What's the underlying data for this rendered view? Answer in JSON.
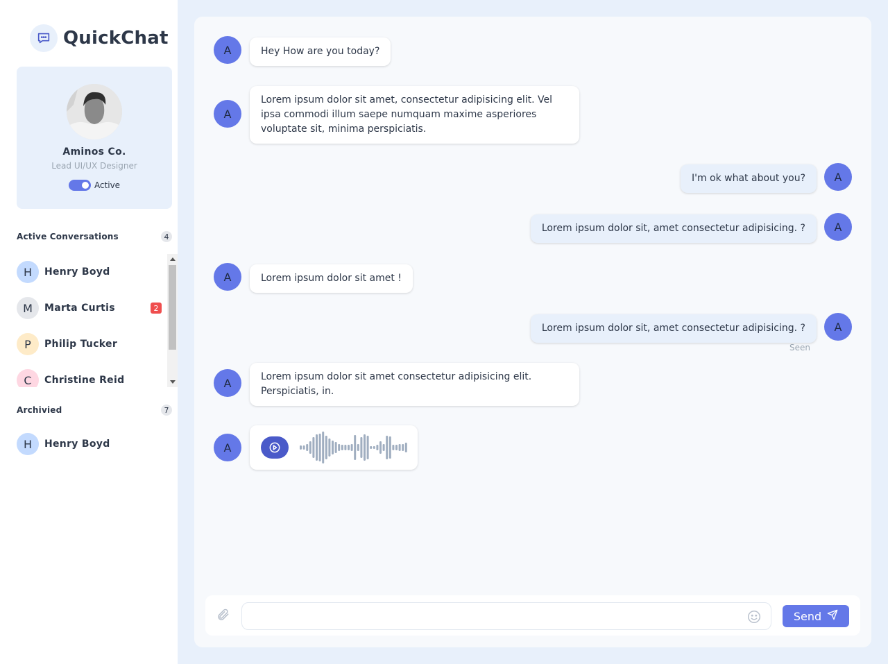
{
  "brand": {
    "title": "QuickChat",
    "icon": "chat-bubble-icon"
  },
  "profile": {
    "name": "Aminos Co.",
    "role": "Lead UI/UX Designer",
    "status_label": "Active",
    "status_on": true
  },
  "active_conversations": {
    "title": "Active Conversations",
    "count": "4",
    "items": [
      {
        "initial": "H",
        "name": "Henry Boyd",
        "color": "#c3dafe",
        "unread": ""
      },
      {
        "initial": "M",
        "name": "Marta Curtis",
        "color": "#e5e7eb",
        "unread": "2"
      },
      {
        "initial": "P",
        "name": "Philip Tucker",
        "color": "#feebc8",
        "unread": ""
      },
      {
        "initial": "C",
        "name": "Christine Reid",
        "color": "#fed7e2",
        "unread": ""
      }
    ]
  },
  "archived": {
    "title": "Archivied",
    "count": "7",
    "items": [
      {
        "initial": "H",
        "name": "Henry Boyd",
        "color": "#c3dafe"
      }
    ]
  },
  "messages": [
    {
      "from": "in",
      "avatar": "A",
      "text": "Hey How are you today?"
    },
    {
      "from": "in",
      "avatar": "A",
      "text": "Lorem ipsum dolor sit amet, consectetur adipisicing elit. Vel ipsa commodi illum saepe numquam maxime asperiores voluptate sit, minima perspiciatis."
    },
    {
      "from": "out",
      "avatar": "A",
      "text": "I'm ok what about you?"
    },
    {
      "from": "out",
      "avatar": "A",
      "text": "Lorem ipsum dolor sit, amet consectetur adipisicing. ?"
    },
    {
      "from": "in",
      "avatar": "A",
      "text": "Lorem ipsum dolor sit amet !"
    },
    {
      "from": "out",
      "avatar": "A",
      "text": "Lorem ipsum dolor sit, amet consectetur adipisicing. ?",
      "status": "Seen"
    },
    {
      "from": "in",
      "avatar": "A",
      "text": "Lorem ipsum dolor sit amet consectetur adipisicing elit. Perspiciatis, in."
    },
    {
      "from": "in",
      "avatar": "A",
      "type": "voice",
      "icon": "play-icon"
    }
  ],
  "composer": {
    "placeholder": "",
    "value": "",
    "send_label": "Send",
    "attach_icon": "paperclip-icon",
    "emoji_icon": "smiley-icon",
    "send_icon": "paper-plane-icon"
  },
  "colors": {
    "accent": "#6478e8",
    "panel": "#f7f9fc",
    "background": "#e8f0fb",
    "badge_red": "#ef4e4e"
  }
}
